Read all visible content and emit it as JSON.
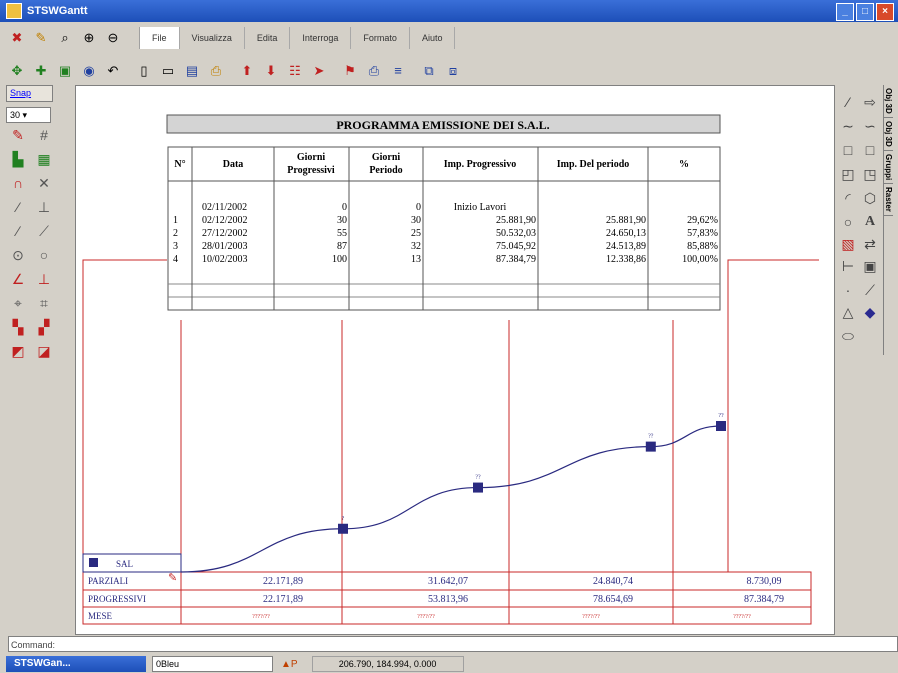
{
  "window": {
    "title": "STSWGantt"
  },
  "menu": [
    "File",
    "Visualizza",
    "Edita",
    "Interroga",
    "Formato",
    "Aiuto"
  ],
  "snap_label": "Snap",
  "zoom_value": "30",
  "right_tabs": [
    "Obj 3D",
    "Obj 3D",
    "Gruppi",
    "Raster"
  ],
  "chart_title": "PROGRAMMA EMISSIONE  DEI S.A.L.",
  "table": {
    "headers": [
      "N°",
      "Data",
      "Giorni Progressivi",
      "Giorni Periodo",
      "Imp. Progressivo",
      "Imp. Del periodo",
      "%"
    ],
    "rows": [
      [
        "",
        "02/11/2002",
        "0",
        "0",
        "Inizio Lavori",
        "",
        ""
      ],
      [
        "1",
        "02/12/2002",
        "30",
        "30",
        "25.881,90",
        "25.881,90",
        "29,62%"
      ],
      [
        "2",
        "27/12/2002",
        "55",
        "25",
        "50.532,03",
        "24.650,13",
        "57,83%"
      ],
      [
        "3",
        "28/01/2003",
        "87",
        "32",
        "75.045,92",
        "24.513,89",
        "85,88%"
      ],
      [
        "4",
        "10/02/2003",
        "100",
        "13",
        "87.384,79",
        "12.338,86",
        "100,00%"
      ]
    ]
  },
  "chart_data": {
    "type": "line",
    "series": [
      {
        "name": "SAL",
        "x": [
          0,
          30,
          55,
          87,
          100
        ],
        "values": [
          0,
          29.62,
          57.83,
          85.88,
          100
        ]
      }
    ],
    "marker_labels": [
      "?",
      "??",
      "??",
      "??"
    ],
    "xlabel": "",
    "ylabel": "",
    "xlim": [
      0,
      100
    ],
    "ylim": [
      0,
      100
    ]
  },
  "bottom_table": {
    "row_labels": [
      "PARZIALI",
      "PROGRESSIVI",
      "MESE"
    ],
    "parziali": [
      "22.171,89",
      "31.642,07",
      "24.840,74",
      "8.730,09"
    ],
    "progressivi": [
      "22.171,89",
      "53.813,96",
      "78.654,69",
      "87.384,79"
    ],
    "mese": [
      "????/??",
      "????/??",
      "????/??",
      "????/??"
    ]
  },
  "command_label": "Command:",
  "taskbar": {
    "task": "STSWGan...",
    "combo": "0Bleu",
    "coords": "206.790, 184.994, 0.000"
  }
}
